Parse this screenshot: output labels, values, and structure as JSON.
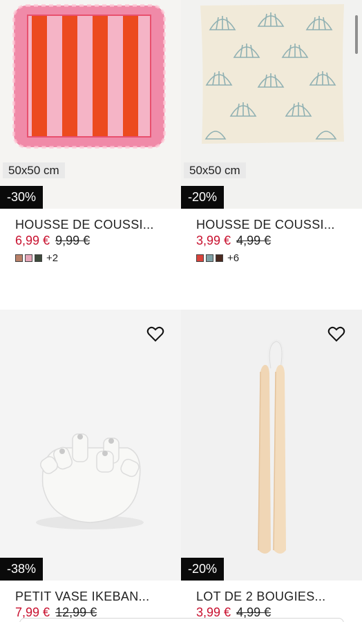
{
  "products": [
    {
      "title": "HOUSSE DE COUSSI...",
      "price_now": "6,99 €",
      "price_old": "9,99 €",
      "size_label": "50x50 cm",
      "discount": "-30%",
      "swatches": [
        "#b98068",
        "#e7a6b9",
        "#3e4a3c"
      ],
      "more_colors": "+2",
      "image": "pink-red-striped-ruffle-cushion"
    },
    {
      "title": "HOUSSE DE COUSSI...",
      "price_now": "3,99 €",
      "price_old": "4,99 €",
      "size_label": "50x50 cm",
      "discount": "-20%",
      "swatches": [
        "#d8433b",
        "#7ea0a4",
        "#4b2a20"
      ],
      "more_colors": "+6",
      "image": "shell-print-cushion"
    },
    {
      "title": "PETIT VASE IKEBAN...",
      "price_now": "7,99 €",
      "price_old": "12,99 €",
      "discount": "-38%",
      "image": "white-ceramic-ikebana-vase",
      "favorite_icon": "heart-outline-icon"
    },
    {
      "title": "LOT DE 2 BOUGIES...",
      "price_now": "3,99 €",
      "price_old": "4,99 €",
      "discount": "-20%",
      "image": "cream-taper-candles",
      "favorite_icon": "heart-outline-icon"
    }
  ],
  "colors": {
    "sale_red": "#c8102e",
    "badge_black": "#0a0a0a",
    "image_bg": "#f3f3f3"
  }
}
